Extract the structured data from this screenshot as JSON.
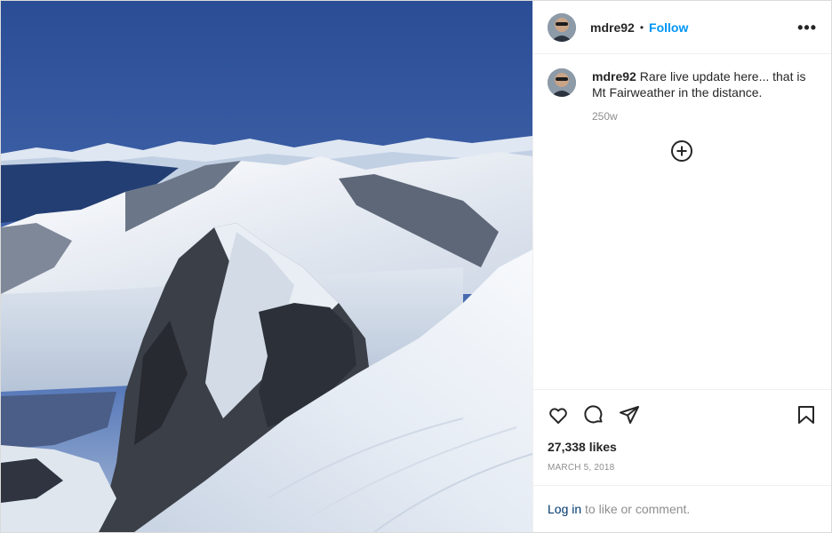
{
  "post": {
    "username": "mdre92",
    "follow_label": "Follow",
    "separator": "•",
    "more_label": "•••",
    "caption": "Rare live update here... that is Mt Fairweather in the distance.",
    "age": "250w",
    "likes": "27,338 likes",
    "date": "MARCH 5, 2018",
    "login_link": "Log in",
    "login_suffix": " to like or comment."
  },
  "icons": {
    "avatar": "avatar",
    "load_more": "plus-circle-icon",
    "like": "heart-icon",
    "comment": "comment-icon",
    "share": "share-icon",
    "save": "bookmark-icon",
    "more": "more-options-icon"
  },
  "colors": {
    "link": "#0095f6",
    "login_link": "#00376b",
    "muted": "#8e8e8e",
    "text": "#262626",
    "border": "#dbdbdb"
  }
}
